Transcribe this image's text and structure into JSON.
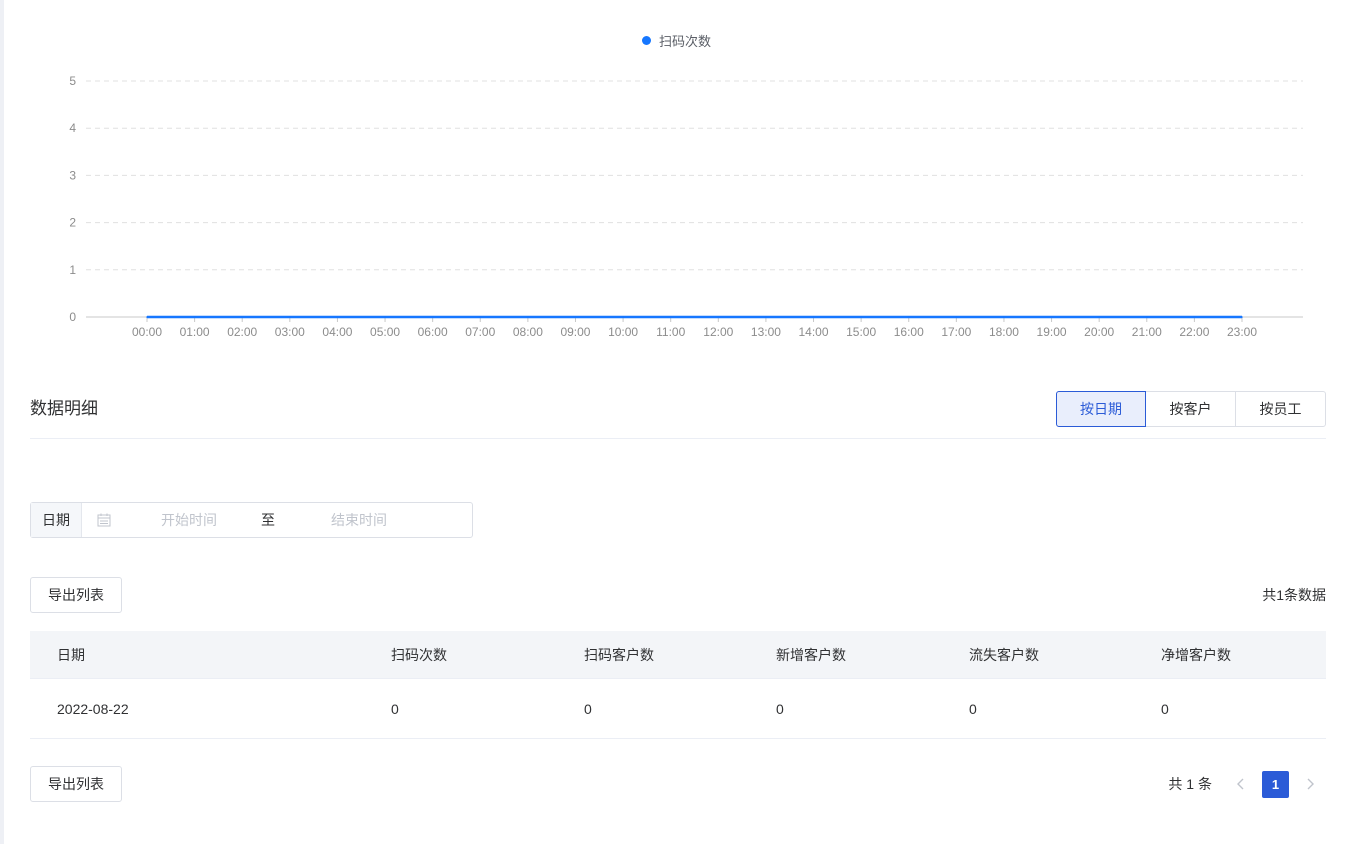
{
  "colors": {
    "series": "#1677ff",
    "accent": "#2b5bd7",
    "grid": "#e0e0e0",
    "axis_text": "#8c8c8c"
  },
  "chart_data": {
    "type": "line",
    "legend": "扫码次数",
    "x": [
      "00:00",
      "01:00",
      "02:00",
      "03:00",
      "04:00",
      "05:00",
      "06:00",
      "07:00",
      "08:00",
      "09:00",
      "10:00",
      "11:00",
      "12:00",
      "13:00",
      "14:00",
      "15:00",
      "16:00",
      "17:00",
      "18:00",
      "19:00",
      "20:00",
      "21:00",
      "22:00",
      "23:00"
    ],
    "series": [
      {
        "name": "扫码次数",
        "values": [
          0,
          0,
          0,
          0,
          0,
          0,
          0,
          0,
          0,
          0,
          0,
          0,
          0,
          0,
          0,
          0,
          0,
          0,
          0,
          0,
          0,
          0,
          0,
          0
        ]
      }
    ],
    "yticks": [
      0,
      1,
      2,
      3,
      4,
      5
    ],
    "ylim": [
      0,
      5
    ],
    "grid": true,
    "legend_position": "top-center"
  },
  "section": {
    "title": "数据明细",
    "tabs": [
      {
        "label": "按日期",
        "active": true
      },
      {
        "label": "按客户",
        "active": false
      },
      {
        "label": "按员工",
        "active": false
      }
    ]
  },
  "filter": {
    "label": "日期",
    "start_placeholder": "开始时间",
    "separator": "至",
    "end_placeholder": "结束时间"
  },
  "export_label": "导出列表",
  "total_text": "共1条数据",
  "table": {
    "headers": [
      "日期",
      "扫码次数",
      "扫码客户数",
      "新增客户数",
      "流失客户数",
      "净增客户数"
    ],
    "rows": [
      [
        "2022-08-22",
        "0",
        "0",
        "0",
        "0",
        "0"
      ]
    ]
  },
  "pagination": {
    "total_text": "共 1 条",
    "current_page": "1"
  }
}
